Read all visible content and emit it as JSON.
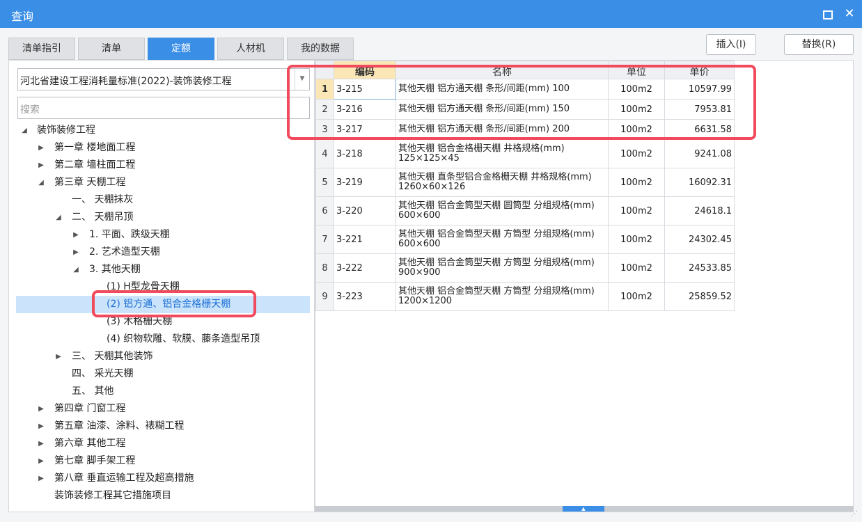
{
  "window": {
    "title": "查询"
  },
  "tabs": [
    {
      "label": "清单指引"
    },
    {
      "label": "清单"
    },
    {
      "label": "定额"
    },
    {
      "label": "人材机"
    },
    {
      "label": "我的数据"
    }
  ],
  "actions": {
    "insert_label": "插入(I)",
    "replace_label": "替换(R)"
  },
  "left": {
    "standard_select": "河北省建设工程消耗量标准(2022)-装饰装修工程",
    "search_placeholder": "搜索"
  },
  "tree": [
    {
      "label": "装饰装修工程"
    },
    {
      "label": "第一章 楼地面工程"
    },
    {
      "label": "第二章 墙柱面工程"
    },
    {
      "label": "第三章 天棚工程"
    },
    {
      "label": "一、 天棚抹灰"
    },
    {
      "label": "二、 天棚吊顶"
    },
    {
      "label": "1. 平面、跌级天棚"
    },
    {
      "label": "2. 艺术造型天棚"
    },
    {
      "label": "3. 其他天棚"
    },
    {
      "label": "(1) H型龙骨天棚"
    },
    {
      "label": "(2) 铝方通、铝合金格栅天棚"
    },
    {
      "label": "(3) 木格栅天棚"
    },
    {
      "label": "(4) 织物软雕、软膜、藤条造型吊顶"
    },
    {
      "label": "三、 天棚其他装饰"
    },
    {
      "label": "四、 采光天棚"
    },
    {
      "label": "五、 其他"
    },
    {
      "label": "第四章 门窗工程"
    },
    {
      "label": "第五章 油漆、涂料、裱糊工程"
    },
    {
      "label": "第六章 其他工程"
    },
    {
      "label": "第七章 脚手架工程"
    },
    {
      "label": "第八章 垂直运输工程及超高措施"
    },
    {
      "label": "装饰装修工程其它措施项目"
    }
  ],
  "grid": {
    "headers": {
      "code": "编码",
      "name": "名称",
      "unit": "单位",
      "price": "单价"
    },
    "rows": [
      {
        "num": "1",
        "code": "3-215",
        "name": "其他天棚 铝方通天棚 条形/间距(mm) 100",
        "unit": "100m2",
        "price": "10597.99"
      },
      {
        "num": "2",
        "code": "3-216",
        "name": "其他天棚 铝方通天棚 条形/间距(mm) 150",
        "unit": "100m2",
        "price": "7953.81"
      },
      {
        "num": "3",
        "code": "3-217",
        "name": "其他天棚 铝方通天棚 条形/间距(mm) 200",
        "unit": "100m2",
        "price": "6631.58"
      },
      {
        "num": "4",
        "code": "3-218",
        "name": "其他天棚 铝合金格栅天棚 井格规格(mm) 125×125×45",
        "unit": "100m2",
        "price": "9241.08"
      },
      {
        "num": "5",
        "code": "3-219",
        "name": "其他天棚 直条型铝合金格栅天棚 井格规格(mm) 1260×60×126",
        "unit": "100m2",
        "price": "16092.31"
      },
      {
        "num": "6",
        "code": "3-220",
        "name": "其他天棚 铝合金筒型天棚 圆筒型 分组规格(mm) 600×600",
        "unit": "100m2",
        "price": "24618.1"
      },
      {
        "num": "7",
        "code": "3-221",
        "name": "其他天棚 铝合金筒型天棚 方筒型 分组规格(mm) 600×600",
        "unit": "100m2",
        "price": "24302.45"
      },
      {
        "num": "8",
        "code": "3-222",
        "name": "其他天棚 铝合金筒型天棚 方筒型 分组规格(mm) 900×900",
        "unit": "100m2",
        "price": "24533.85"
      },
      {
        "num": "9",
        "code": "3-223",
        "name": "其他天棚 铝合金筒型天棚 方筒型 分组规格(mm) 1200×1200",
        "unit": "100m2",
        "price": "25859.52"
      }
    ]
  },
  "colors": {
    "accent": "#3a8ee6",
    "highlight": "#f04a5c",
    "selected_bg": "#cce4fb"
  }
}
